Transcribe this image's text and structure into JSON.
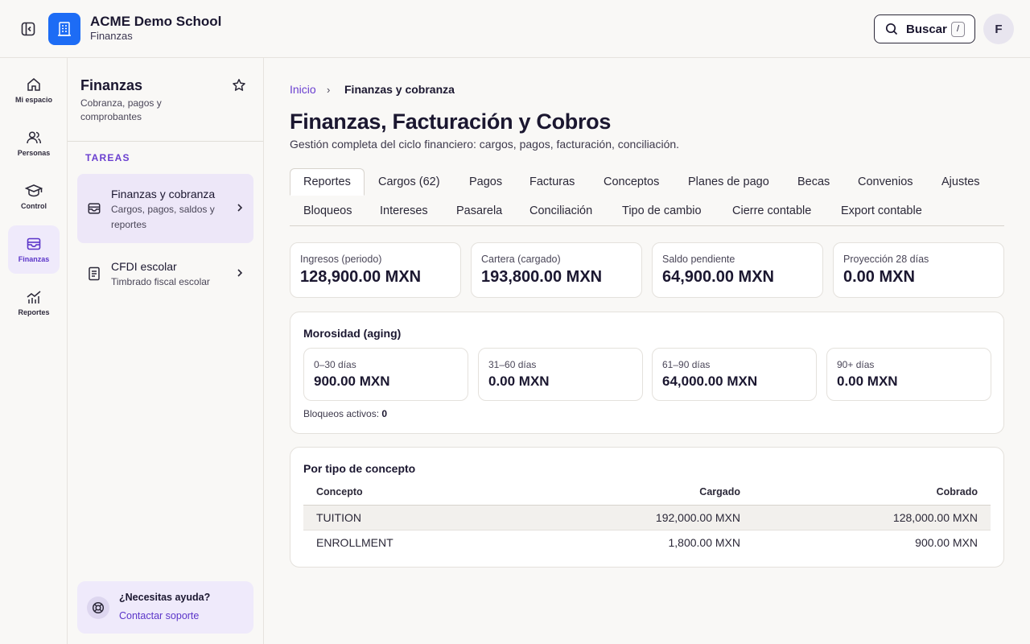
{
  "header": {
    "app_title": "ACME Demo School",
    "app_subtitle": "Finanzas",
    "search_label": "Buscar",
    "search_shortcut": "/",
    "avatar_initial": "F"
  },
  "rail": {
    "items": [
      {
        "label": "Mi espacio",
        "icon": "home-icon"
      },
      {
        "label": "Personas",
        "icon": "users-icon"
      },
      {
        "label": "Control",
        "icon": "graduation-cap-icon"
      },
      {
        "label": "Finanzas",
        "icon": "wallet-icon"
      },
      {
        "label": "Reportes",
        "icon": "chart-icon"
      }
    ],
    "active": "Finanzas"
  },
  "sidebar": {
    "title": "Finanzas",
    "description": "Cobranza, pagos y comprobantes",
    "section_label": "TAREAS",
    "items": [
      {
        "title": "Finanzas y cobranza",
        "subtitle": "Cargos, pagos, saldos y reportes",
        "icon": "wallet-icon"
      },
      {
        "title": "CFDI escolar",
        "subtitle": "Timbrado fiscal escolar",
        "icon": "document-icon"
      }
    ],
    "help": {
      "title": "¿Necesitas ayuda?",
      "link": "Contactar soporte"
    }
  },
  "main": {
    "breadcrumb": {
      "home": "Inicio",
      "separator": "›",
      "current": "Finanzas y cobranza"
    },
    "title": "Finanzas, Facturación y Cobros",
    "subtitle": "Gestión completa del ciclo financiero: cargos, pagos, facturación, conciliación.",
    "tabs": [
      "Reportes",
      "Cargos (62)",
      "Pagos",
      "Facturas",
      "Conceptos",
      "Planes de pago",
      "Becas",
      "Convenios",
      "Ajustes",
      "Bloqueos",
      "Intereses",
      "Pasarela",
      "Conciliación",
      "Tipo de cambio",
      "Cierre contable",
      "Export contable"
    ],
    "active_tab": "Reportes",
    "kpis": [
      {
        "label": "Ingresos (periodo)",
        "value": "128,900.00 MXN"
      },
      {
        "label": "Cartera (cargado)",
        "value": "193,800.00 MXN"
      },
      {
        "label": "Saldo pendiente",
        "value": "64,900.00 MXN"
      },
      {
        "label": "Proyección 28 días",
        "value": "0.00 MXN"
      }
    ],
    "aging": {
      "title": "Morosidad (aging)",
      "buckets": [
        {
          "label": "0–30 días",
          "value": "900.00 MXN"
        },
        {
          "label": "31–60 días",
          "value": "0.00 MXN"
        },
        {
          "label": "61–90 días",
          "value": "64,000.00 MXN"
        },
        {
          "label": "90+ días",
          "value": "0.00 MXN"
        }
      ],
      "blocks_label": "Bloqueos activos:",
      "blocks_value": "0"
    },
    "concept_table": {
      "title": "Por tipo de concepto",
      "columns": [
        "Concepto",
        "Cargado",
        "Cobrado"
      ],
      "rows": [
        [
          "TUITION",
          "192,000.00 MXN",
          "128,000.00 MXN"
        ],
        [
          "ENROLLMENT",
          "1,800.00 MXN",
          "900.00 MXN"
        ]
      ]
    }
  },
  "colors": {
    "accent": "#6a3fd0",
    "brand_blue": "#1d6cf5",
    "active_bg": "#ede7f8",
    "page_bg": "#f9f8f6"
  }
}
